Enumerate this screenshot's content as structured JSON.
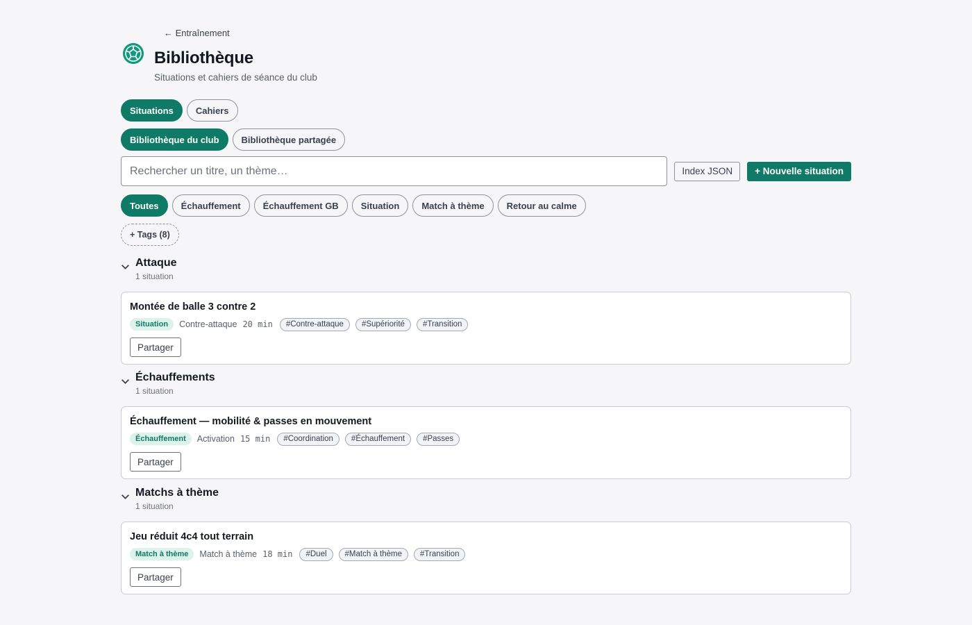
{
  "header": {
    "back_label": "← Entraînement",
    "title": "Bibliothèque",
    "subtitle": "Situations et cahiers de séance du club"
  },
  "view_tabs": [
    {
      "label": "Situations",
      "active": true
    },
    {
      "label": "Cahiers",
      "active": false
    }
  ],
  "library_tabs": [
    {
      "label": "Bibliothèque du club",
      "active": true
    },
    {
      "label": "Bibliothèque partagée",
      "active": false
    }
  ],
  "search": {
    "placeholder": "Rechercher un titre, un thème…",
    "value": "",
    "index_json_label": "Index JSON",
    "new_situation_label": "+ Nouvelle situation"
  },
  "filters": [
    {
      "label": "Toutes",
      "active": true
    },
    {
      "label": "Échauffement",
      "active": false
    },
    {
      "label": "Échauffement GB",
      "active": false
    },
    {
      "label": "Situation",
      "active": false
    },
    {
      "label": "Match à thème",
      "active": false
    },
    {
      "label": "Retour au calme",
      "active": false
    }
  ],
  "tags_button": "+ Tags (8)",
  "sections": [
    {
      "title": "Attaque",
      "count": "1 situation",
      "items": [
        {
          "title": "Montée de balle 3 contre 2",
          "badge": "Situation",
          "theme": "Contre-attaque",
          "duration": "20 min",
          "tags": [
            "#Contre-attaque",
            "#Supériorité",
            "#Transition"
          ],
          "share_label": "Partager"
        }
      ]
    },
    {
      "title": "Échauffements",
      "count": "1 situation",
      "items": [
        {
          "title": "Échauffement — mobilité & passes en mouvement",
          "badge": "Échauffement",
          "theme": "Activation",
          "duration": "15 min",
          "tags": [
            "#Coordination",
            "#Échauffement",
            "#Passes"
          ],
          "share_label": "Partager"
        }
      ]
    },
    {
      "title": "Matchs à thème",
      "count": "1 situation",
      "items": [
        {
          "title": "Jeu réduit 4c4 tout terrain",
          "badge": "Match à thème",
          "theme": "Match à thème",
          "duration": "18 min",
          "tags": [
            "#Duel",
            "#Match à thème",
            "#Transition"
          ],
          "share_label": "Partager"
        }
      ]
    }
  ],
  "colors": {
    "accent": "#0f7a66",
    "badge_bg": "#ddf2ea",
    "background": "#f6f6f8"
  },
  "icons": {
    "logo": "handball-logo-icon",
    "back": "arrow-left-icon",
    "collapse": "chevron-down-icon"
  }
}
